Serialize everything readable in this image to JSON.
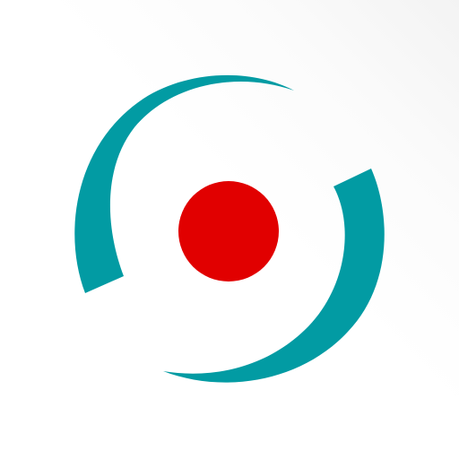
{
  "logo": {
    "icon": "target-logo-icon",
    "colors": {
      "ring": "#029ba3",
      "center": "#e10000",
      "background": "#ffffff"
    }
  }
}
